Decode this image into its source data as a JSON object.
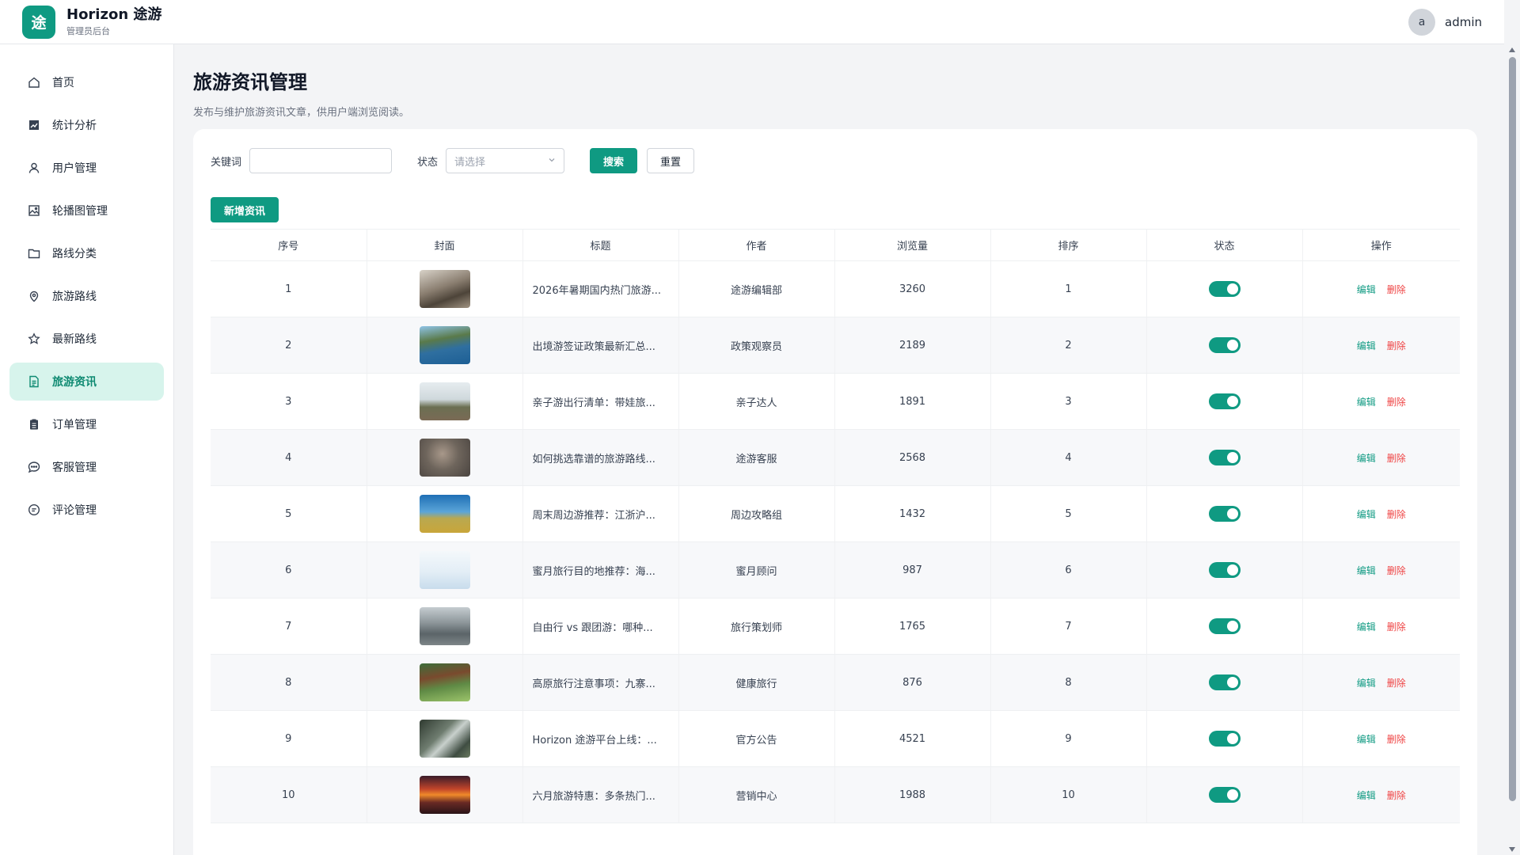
{
  "header": {
    "logo_char": "途",
    "brand_name": "Horizon 途游",
    "brand_sub": "管理员后台",
    "avatar_letter": "a",
    "user_name": "admin"
  },
  "sidebar": {
    "items": [
      {
        "label": "首页",
        "icon": "home-icon",
        "active": false
      },
      {
        "label": "统计分析",
        "icon": "chart-icon",
        "active": false
      },
      {
        "label": "用户管理",
        "icon": "user-icon",
        "active": false
      },
      {
        "label": "轮播图管理",
        "icon": "image-icon",
        "active": false
      },
      {
        "label": "路线分类",
        "icon": "folder-icon",
        "active": false
      },
      {
        "label": "旅游路线",
        "icon": "location-pin-icon",
        "active": false
      },
      {
        "label": "最新路线",
        "icon": "star-icon",
        "active": false
      },
      {
        "label": "旅游资讯",
        "icon": "document-icon",
        "active": true
      },
      {
        "label": "订单管理",
        "icon": "clipboard-icon",
        "active": false
      },
      {
        "label": "客服管理",
        "icon": "chat-icon",
        "active": false
      },
      {
        "label": "评论管理",
        "icon": "comment-icon",
        "active": false
      }
    ]
  },
  "page": {
    "title": "旅游资讯管理",
    "description": "发布与维护旅游资讯文章，供用户端浏览阅读。"
  },
  "filter": {
    "keyword_label": "关键词",
    "keyword_value": "",
    "keyword_placeholder": "",
    "status_label": "状态",
    "status_placeholder": "请选择",
    "search_label": "搜索",
    "reset_label": "重置"
  },
  "toolbar": {
    "add_label": "新增资讯"
  },
  "colors": {
    "accent": "#0f9a82",
    "active_bg": "#d7f4ec",
    "danger": "#ef4444"
  },
  "table": {
    "columns": [
      "序号",
      "封面",
      "标题",
      "作者",
      "浏览量",
      "排序",
      "状态",
      "操作"
    ],
    "edit_label": "编辑",
    "delete_label": "删除",
    "rows": [
      {
        "index": "1",
        "title": "2026年暑期国内热门旅游...",
        "author": "途游编辑部",
        "views": "3260",
        "sort": "1",
        "enabled": true
      },
      {
        "index": "2",
        "title": "出境游签证政策最新汇总...",
        "author": "政策观察员",
        "views": "2189",
        "sort": "2",
        "enabled": true
      },
      {
        "index": "3",
        "title": "亲子游出行清单：带娃旅...",
        "author": "亲子达人",
        "views": "1891",
        "sort": "3",
        "enabled": true
      },
      {
        "index": "4",
        "title": "如何挑选靠谱的旅游路线...",
        "author": "途游客服",
        "views": "2568",
        "sort": "4",
        "enabled": true
      },
      {
        "index": "5",
        "title": "周末周边游推荐：江浙沪...",
        "author": "周边攻略组",
        "views": "1432",
        "sort": "5",
        "enabled": true
      },
      {
        "index": "6",
        "title": "蜜月旅行目的地推荐：海...",
        "author": "蜜月顾问",
        "views": "987",
        "sort": "6",
        "enabled": true
      },
      {
        "index": "7",
        "title": "自由行 vs 跟团游：哪种...",
        "author": "旅行策划师",
        "views": "1765",
        "sort": "7",
        "enabled": true
      },
      {
        "index": "8",
        "title": "高原旅行注意事项：九寨...",
        "author": "健康旅行",
        "views": "876",
        "sort": "8",
        "enabled": true
      },
      {
        "index": "9",
        "title": "Horizon 途游平台上线：...",
        "author": "官方公告",
        "views": "4521",
        "sort": "9",
        "enabled": true
      },
      {
        "index": "10",
        "title": "六月旅游特惠：多条热门...",
        "author": "营销中心",
        "views": "1988",
        "sort": "10",
        "enabled": true
      }
    ]
  }
}
